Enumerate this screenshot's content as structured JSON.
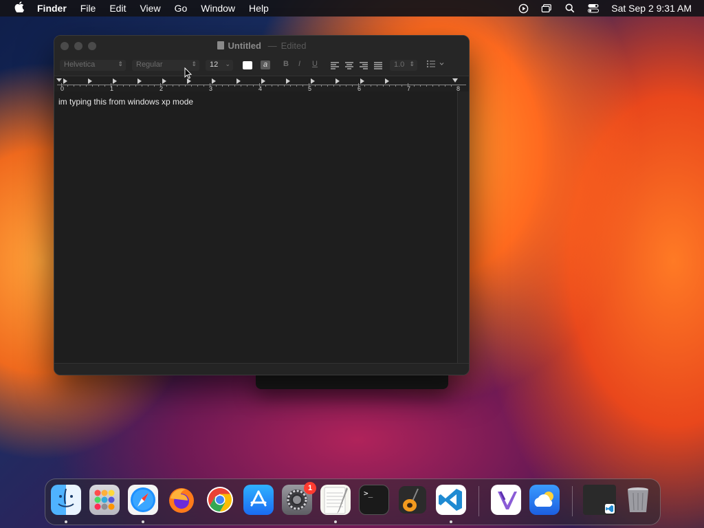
{
  "menubar": {
    "app_name": "Finder",
    "items": [
      "File",
      "Edit",
      "View",
      "Go",
      "Window",
      "Help"
    ],
    "clock": "Sat Sep 2  9:31 AM",
    "tray_icons": [
      "play-circle-icon",
      "screen-mirroring-icon",
      "spotlight-search-icon",
      "control-center-icon"
    ]
  },
  "window": {
    "title": "Untitled",
    "separator": "—",
    "status": "Edited",
    "toolbar": {
      "font_family": "Helvetica",
      "font_style": "Regular",
      "font_size": "12",
      "highlight_glyph": "a",
      "bold": "B",
      "italic": "I",
      "underline": "U",
      "line_spacing": "1.0"
    },
    "ruler": {
      "numbers": [
        "0",
        "1",
        "2",
        "3",
        "4",
        "5",
        "6",
        "7",
        "8"
      ]
    },
    "document_text": "im typing this from windows xp mode"
  },
  "dock": {
    "apps": [
      {
        "name": "finder-icon",
        "running": true
      },
      {
        "name": "launchpad-icon",
        "running": false
      },
      {
        "name": "safari-icon",
        "running": true
      },
      {
        "name": "firefox-icon",
        "running": false
      },
      {
        "name": "chrome-icon",
        "running": false
      },
      {
        "name": "app-store-icon",
        "running": false
      },
      {
        "name": "system-settings-icon",
        "running": false,
        "badge": "1"
      },
      {
        "name": "textedit-icon",
        "running": true
      },
      {
        "name": "terminal-icon",
        "running": false
      },
      {
        "name": "garageband-icon",
        "running": false
      },
      {
        "name": "vscode-icon",
        "running": true
      },
      {
        "name": "visual-studio-icon",
        "running": false
      },
      {
        "name": "weather-icon",
        "running": false
      },
      {
        "name": "minimized-window-icon",
        "running": false
      },
      {
        "name": "trash-icon",
        "running": false
      }
    ],
    "terminal_glyph": ">_"
  }
}
